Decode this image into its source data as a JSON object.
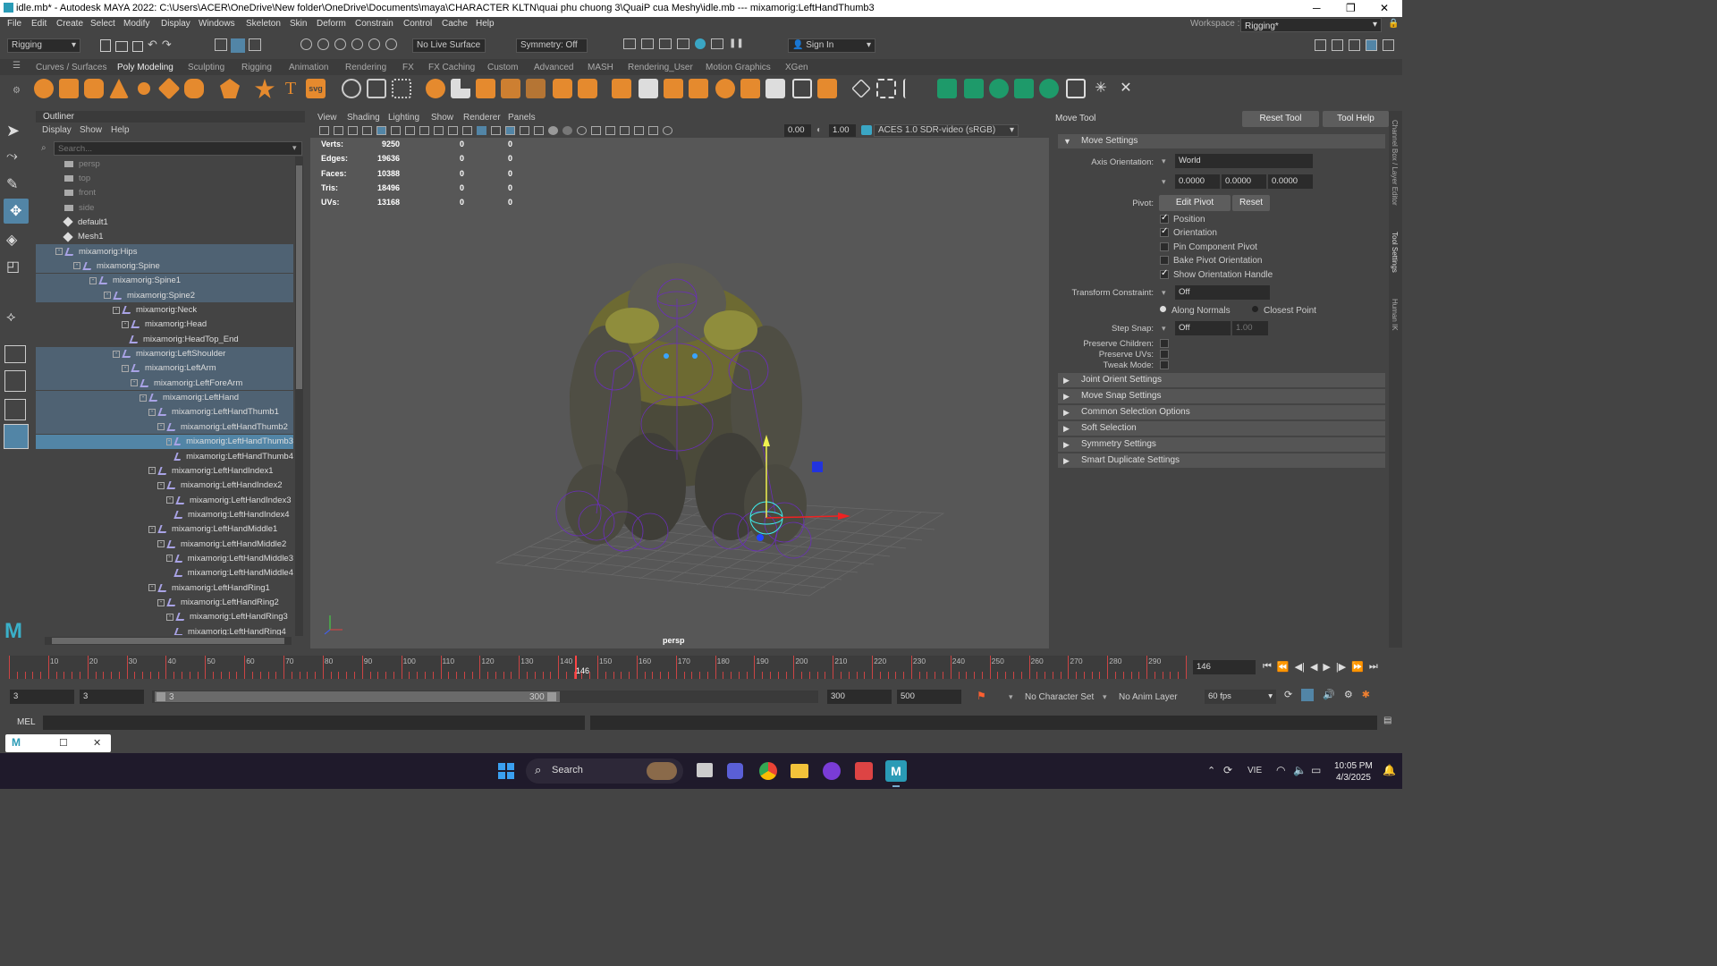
{
  "title": "idle.mb* - Autodesk MAYA 2022: C:\\Users\\ACER\\OneDrive\\New folder\\OneDrive\\Documents\\maya\\CHARACTER KLTN\\quai phu chuong 3\\QuaiP cua Meshy\\idle.mb   ---   mixamorig:LeftHandThumb3",
  "menu": [
    "File",
    "Edit",
    "Create",
    "Select",
    "Modify",
    "Display",
    "Windows",
    "Skeleton",
    "Skin",
    "Deform",
    "Constrain",
    "Control",
    "Cache",
    "Help"
  ],
  "workspace_label": "Workspace :",
  "workspace_value": "Rigging*",
  "menuset": "Rigging",
  "live_surface": "No Live Surface",
  "symmetry": "Symmetry: Off",
  "sign_in": "Sign In",
  "shelf_tabs": [
    "Curves / Surfaces",
    "Poly Modeling",
    "Sculpting",
    "Rigging",
    "Animation",
    "Rendering",
    "FX",
    "FX Caching",
    "Custom",
    "Advanced",
    "MASH",
    "Rendering_User",
    "Motion Graphics",
    "XGen"
  ],
  "outliner": {
    "title": "Outliner",
    "menu": [
      "Display",
      "Show",
      "Help"
    ],
    "search_placeholder": "Search...",
    "items": [
      {
        "label": "persp",
        "dim": true
      },
      {
        "label": "top",
        "dim": true
      },
      {
        "label": "front",
        "dim": true
      },
      {
        "label": "side",
        "dim": true
      },
      {
        "label": "default1"
      },
      {
        "label": "Mesh1"
      },
      {
        "label": "mixamorig:Hips"
      },
      {
        "label": "mixamorig:Spine"
      },
      {
        "label": "mixamorig:Spine1"
      },
      {
        "label": "mixamorig:Spine2"
      },
      {
        "label": "mixamorig:Neck"
      },
      {
        "label": "mixamorig:Head"
      },
      {
        "label": "mixamorig:HeadTop_End"
      },
      {
        "label": "mixamorig:LeftShoulder"
      },
      {
        "label": "mixamorig:LeftArm"
      },
      {
        "label": "mixamorig:LeftForeArm"
      },
      {
        "label": "mixamorig:LeftHand"
      },
      {
        "label": "mixamorig:LeftHandThumb1"
      },
      {
        "label": "mixamorig:LeftHandThumb2"
      },
      {
        "label": "mixamorig:LeftHandThumb3"
      },
      {
        "label": "mixamorig:LeftHandThumb4"
      },
      {
        "label": "mixamorig:LeftHandIndex1"
      },
      {
        "label": "mixamorig:LeftHandIndex2"
      },
      {
        "label": "mixamorig:LeftHandIndex3"
      },
      {
        "label": "mixamorig:LeftHandIndex4"
      },
      {
        "label": "mixamorig:LeftHandMiddle1"
      },
      {
        "label": "mixamorig:LeftHandMiddle2"
      },
      {
        "label": "mixamorig:LeftHandMiddle3"
      },
      {
        "label": "mixamorig:LeftHandMiddle4"
      },
      {
        "label": "mixamorig:LeftHandRing1"
      },
      {
        "label": "mixamorig:LeftHandRing2"
      },
      {
        "label": "mixamorig:LeftHandRing3"
      },
      {
        "label": "mixamorig:LeftHandRing4"
      }
    ]
  },
  "viewport": {
    "menu": [
      "View",
      "Shading",
      "Lighting",
      "Show",
      "Renderer",
      "Panels"
    ],
    "val1": "0.00",
    "val2": "1.00",
    "colorspace": "ACES 1.0 SDR-video (sRGB)",
    "camera": "persp",
    "hud": [
      {
        "k": "Verts:",
        "a": "9250",
        "b": "0",
        "c": "0"
      },
      {
        "k": "Edges:",
        "a": "19636",
        "b": "0",
        "c": "0"
      },
      {
        "k": "Faces:",
        "a": "10388",
        "b": "0",
        "c": "0"
      },
      {
        "k": "Tris:",
        "a": "18496",
        "b": "0",
        "c": "0"
      },
      {
        "k": "UVs:",
        "a": "13168",
        "b": "0",
        "c": "0"
      }
    ]
  },
  "tool": {
    "name": "Move Tool",
    "reset": "Reset Tool",
    "help": "Tool Help",
    "move_settings": "Move Settings",
    "axis_label": "Axis Orientation:",
    "axis_value": "World",
    "x": "0.0000",
    "y": "0.0000",
    "z": "0.0000",
    "pivot_label": "Pivot:",
    "edit_pivot": "Edit Pivot",
    "reset_btn": "Reset",
    "checks": [
      {
        "label": "Position",
        "on": true
      },
      {
        "label": "Orientation",
        "on": true
      },
      {
        "label": "Pin Component Pivot",
        "on": false
      },
      {
        "label": "Bake Pivot Orientation",
        "on": false
      },
      {
        "label": "Show Orientation Handle",
        "on": true
      }
    ],
    "constraint_label": "Transform Constraint:",
    "constraint_value": "Off",
    "along": "Along Normals",
    "closest": "Closest Point",
    "step_label": "Step Snap:",
    "step_value": "Off",
    "step_num": "1.00",
    "preserve_children": "Preserve Children:",
    "preserve_uvs": "Preserve UVs:",
    "tweak": "Tweak Mode:",
    "sections": [
      "Joint Orient Settings",
      "Move Snap Settings",
      "Common Selection Options",
      "Soft Selection",
      "Symmetry Settings",
      "Smart Duplicate Settings"
    ]
  },
  "side_tabs": [
    "Channel Box / Layer Editor",
    "Tool Settings",
    "Human IK"
  ],
  "timeline": {
    "ticks": [
      "10",
      "20",
      "30",
      "40",
      "50",
      "60",
      "70",
      "80",
      "90",
      "100",
      "110",
      "120",
      "130",
      "140",
      "150",
      "160",
      "170",
      "180",
      "190",
      "200",
      "210",
      "220",
      "230",
      "240",
      "250",
      "260",
      "270",
      "280",
      "290"
    ],
    "current": "146",
    "current_field": "146"
  },
  "range": {
    "start": "3",
    "inner_start": "3",
    "slider_start": "3",
    "slider_end": "300",
    "end": "300",
    "anim_end": "500",
    "char_set": "No Character Set",
    "anim_layer": "No Anim Layer",
    "fps": "60 fps"
  },
  "cmd": {
    "label": "MEL"
  },
  "taskbar": {
    "search": "Search",
    "lang": "VIE",
    "time": "10:05 PM",
    "date": "4/3/2025"
  },
  "colors": {
    "selected_row": "#5285a6",
    "highlight_row": "#4f6273",
    "joint": "#a9a3e6",
    "playhead": "#ff4444"
  }
}
